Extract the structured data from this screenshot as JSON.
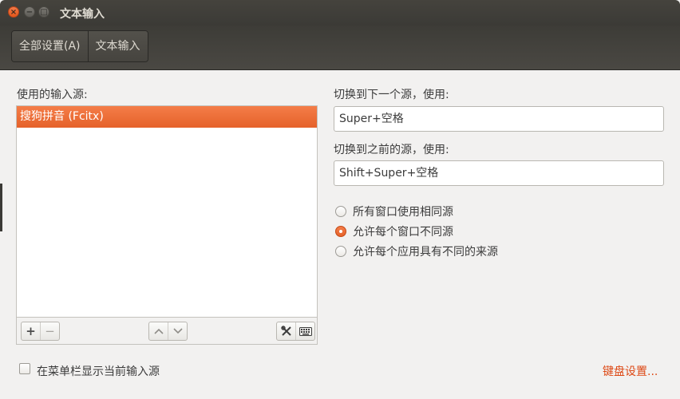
{
  "window": {
    "title": "文本输入"
  },
  "breadcrumb": {
    "all_settings": "全部设置(A)",
    "current": "文本输入"
  },
  "left": {
    "sources_label": "使用的输入源:",
    "sources": [
      "搜狗拼音 (Fcitx)"
    ],
    "add_label": "+",
    "remove_label": "−"
  },
  "right": {
    "next_label": "切换到下一个源，使用:",
    "next_value": "Super+空格",
    "prev_label": "切换到之前的源，使用:",
    "prev_value": "Shift+Super+空格",
    "radios": [
      {
        "label": "所有窗口使用相同源",
        "selected": false
      },
      {
        "label": "允许每个窗口不同源",
        "selected": true
      },
      {
        "label": "允许每个应用具有不同的来源",
        "selected": false
      }
    ]
  },
  "footer": {
    "show_in_menubar_label": "在菜单栏显示当前输入源",
    "show_in_menubar_checked": false,
    "keyboard_settings_link": "键盘设置..."
  },
  "colors": {
    "accent": "#e5622a",
    "link": "#dd4814",
    "titlebar": "#3b3a36"
  },
  "icons": [
    "close-icon",
    "minimize-icon",
    "maximize-icon",
    "plus-icon",
    "minus-icon",
    "chevron-up-icon",
    "chevron-down-icon",
    "tools-icon",
    "keyboard-icon"
  ]
}
